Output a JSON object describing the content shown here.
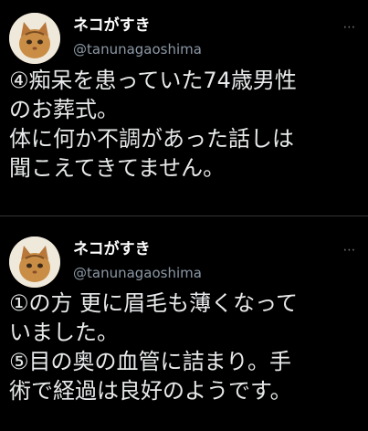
{
  "tweets": [
    {
      "display_name": "ネコがすき",
      "handle": "@tanunagaoshima",
      "text": "④痴呆を患っていた74歳男性\nのお葬式。\n体に何か不調があった話しは\n聞こえてきてません。"
    },
    {
      "display_name": "ネコがすき",
      "handle": "@tanunagaoshima",
      "text": "①の方 更に眉毛も薄くなって\nいました。\n⑤目の奥の血管に詰まり。手\n術で経過は良好のようです。"
    }
  ],
  "more_icon": "⋯",
  "colors": {
    "background": "#000000",
    "text": "#e7e9ea",
    "secondary": "#8b98a5",
    "divider": "#2f3336"
  }
}
